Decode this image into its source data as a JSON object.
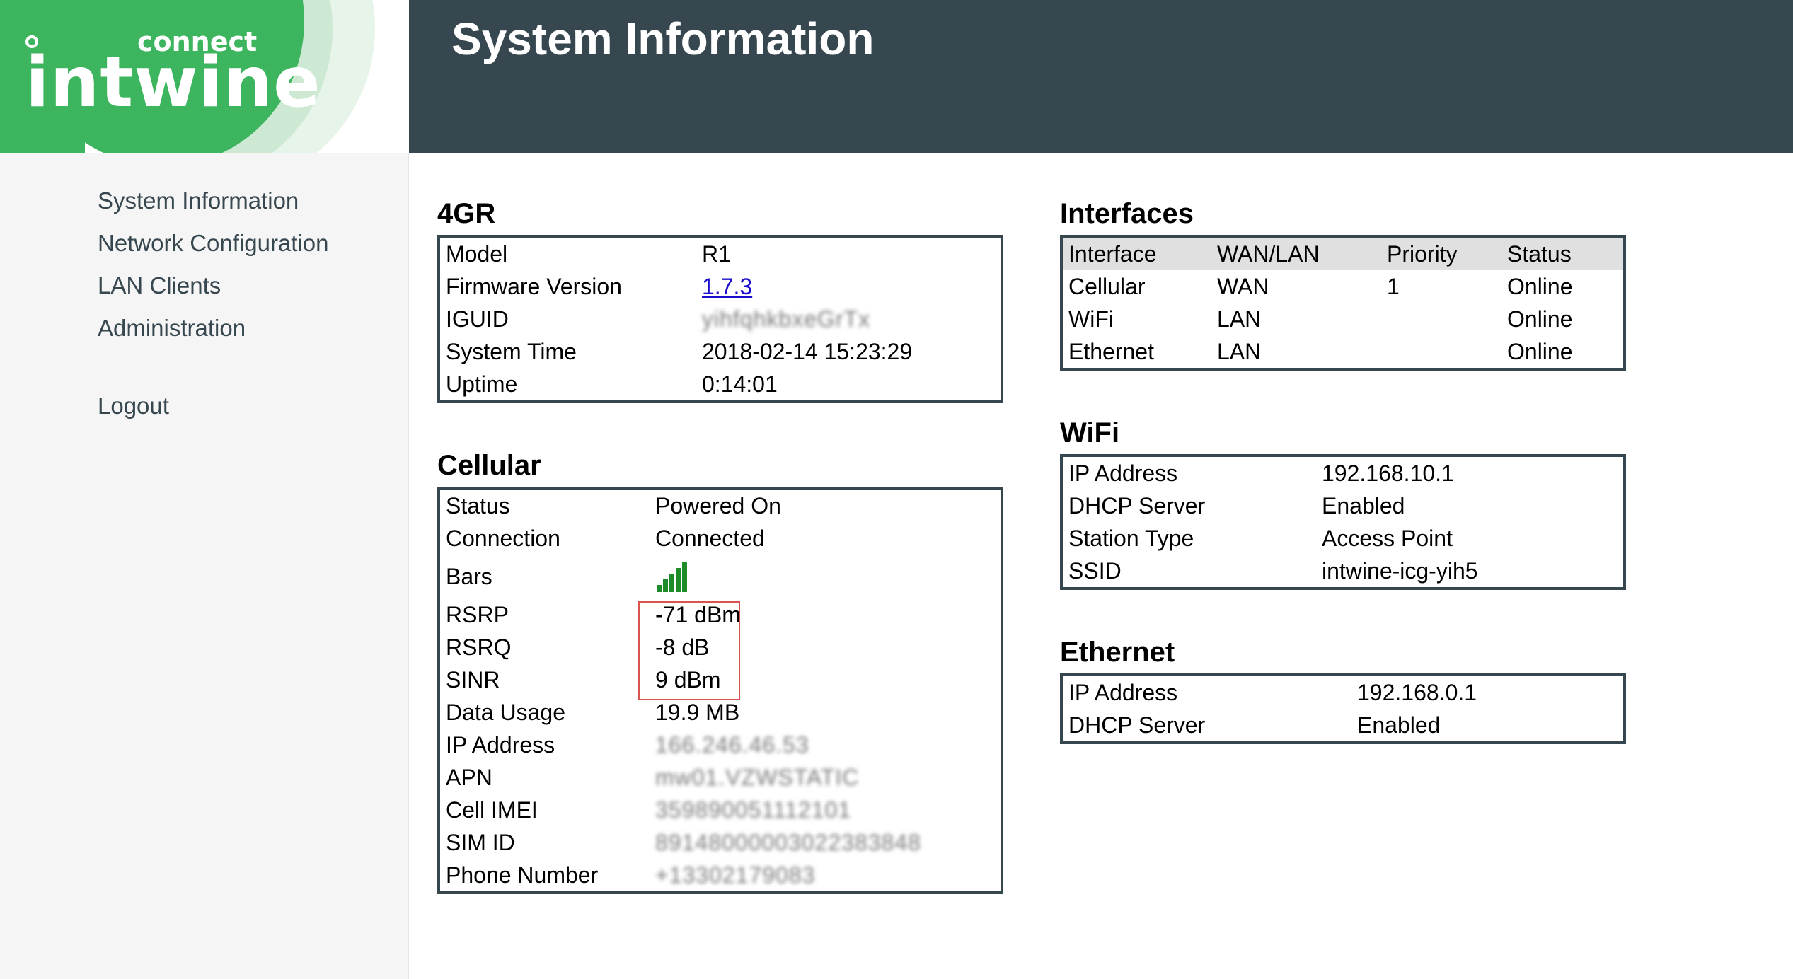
{
  "brand": {
    "logo_main": "intwine",
    "logo_sub": "connect",
    "green": "#3cb55e"
  },
  "header": {
    "title": "System Information",
    "bg": "#37474f"
  },
  "sidebar": {
    "items": [
      {
        "label": "System Information"
      },
      {
        "label": "Network Configuration"
      },
      {
        "label": "LAN Clients"
      },
      {
        "label": "Administration"
      }
    ],
    "logout": "Logout"
  },
  "fourgr": {
    "title": "4GR",
    "rows": [
      {
        "label": "Model",
        "value": "R1"
      },
      {
        "label": "Firmware Version",
        "value": "1.7.3"
      },
      {
        "label": "IGUID",
        "value": "yihfqhkbxeGrTx"
      },
      {
        "label": "System Time",
        "value": "2018-02-14 15:23:29"
      },
      {
        "label": "Uptime",
        "value": "0:14:01"
      }
    ]
  },
  "cellular": {
    "title": "Cellular",
    "rows": [
      {
        "label": "Status",
        "value": "Powered On"
      },
      {
        "label": "Connection",
        "value": "Connected"
      },
      {
        "label": "Bars",
        "value": "",
        "icon": "signal-bars-icon"
      },
      {
        "label": "RSRP",
        "value": "-71 dBm"
      },
      {
        "label": "RSRQ",
        "value": "-8 dB"
      },
      {
        "label": "SINR",
        "value": "9 dBm"
      },
      {
        "label": "Data Usage",
        "value": "19.9 MB"
      },
      {
        "label": "IP Address",
        "value": "166.246.46.53"
      },
      {
        "label": "APN",
        "value": "mw01.VZWSTATIC"
      },
      {
        "label": "Cell IMEI",
        "value": "359890051112101"
      },
      {
        "label": "SIM ID",
        "value": "89148000003022383848"
      },
      {
        "label": "Phone Number",
        "value": "+13302179083"
      }
    ],
    "signal_bars": 5,
    "signal_color": "#1e8c28"
  },
  "interfaces": {
    "title": "Interfaces",
    "headers": [
      "Interface",
      "WAN/LAN",
      "Priority",
      "Status"
    ],
    "rows": [
      [
        "Cellular",
        "WAN",
        "1",
        "Online"
      ],
      [
        "WiFi",
        "LAN",
        "",
        "Online"
      ],
      [
        "Ethernet",
        "LAN",
        "",
        "Online"
      ]
    ]
  },
  "wifi": {
    "title": "WiFi",
    "rows": [
      {
        "label": "IP Address",
        "value": "192.168.10.1"
      },
      {
        "label": "DHCP Server",
        "value": "Enabled"
      },
      {
        "label": "Station Type",
        "value": "Access Point"
      },
      {
        "label": "SSID",
        "value": "intwine-icg-yih5"
      }
    ]
  },
  "ethernet": {
    "title": "Ethernet",
    "rows": [
      {
        "label": "IP Address",
        "value": "192.168.0.1"
      },
      {
        "label": "DHCP Server",
        "value": "Enabled"
      }
    ]
  }
}
